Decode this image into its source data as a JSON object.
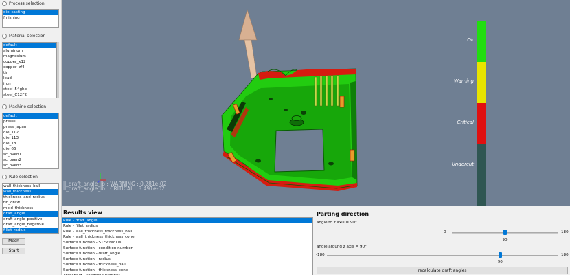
{
  "process_selection": {
    "title": "Process selection",
    "items": [
      "die_casting",
      "finishing"
    ],
    "selected_index": 0
  },
  "material_selection": {
    "title": "Material selection",
    "items": [
      "default",
      "aluminum",
      "magnesium",
      "copper_x12",
      "copper_zf4",
      "tin",
      "lead",
      "iron",
      "steel_54ghb",
      "steel_C12F2"
    ],
    "selected_index": 0
  },
  "machine_selection": {
    "title": "Machine selection",
    "items": [
      "default",
      "press1",
      "press_japan",
      "die_112",
      "die_113",
      "die_78",
      "die_66",
      "sc_oven1",
      "sc_oven2",
      "sc_oven3"
    ],
    "selected_index": 0
  },
  "rule_selection": {
    "title": "Rule selection",
    "items": [
      "wall_thickness_ball",
      "wall_thickness",
      "thickness_and_radius",
      "tin_draw",
      "mold_thickness",
      "draft_angle",
      "draft_angle_positive",
      "draft_angle_negative",
      "fillet_radius"
    ],
    "selected_indices": [
      1,
      5,
      8
    ]
  },
  "buttons": {
    "mesh": "Mesh",
    "start": "Start"
  },
  "viewport": {
    "overlay_lines": [
      "ll_draft_angle_lb : WARNING : 0.281e-02",
      "ll_draft_angle_lb : CRITICAL : 3.491e-02"
    ],
    "legend": [
      {
        "label": "Ok",
        "color": "#22dd11"
      },
      {
        "label": "Warning",
        "color": "#e8e400"
      },
      {
        "label": "Critical",
        "color": "#e01010"
      },
      {
        "label": "Undercut",
        "color": "#2f5652"
      }
    ]
  },
  "results": {
    "title": "Results view",
    "items": [
      "Rule - draft_angle",
      "Rule - fillet_radius",
      "Rule - wall_thickness_thickness_ball",
      "Rule - wall_thickness_thickness_cone",
      "Surface function - STEP radius",
      "Surface function - condition number",
      "Surface function - draft_angle",
      "Surface function - radius",
      "Surface function - thickness_ball",
      "Surface function - thickness_cone",
      "Threshold - condition number"
    ],
    "selected_index": 0
  },
  "parting": {
    "title": "Parting direction",
    "slider1": {
      "label": "angle to z axis = 90°",
      "min": "0",
      "max": "180",
      "value": "90",
      "fraction": 0.5
    },
    "slider2": {
      "label": "angle around z axis = 90°",
      "min": "-180",
      "max": "180",
      "value": "90",
      "fraction": 0.75
    },
    "recalc_label": "recalculate draft angles"
  }
}
